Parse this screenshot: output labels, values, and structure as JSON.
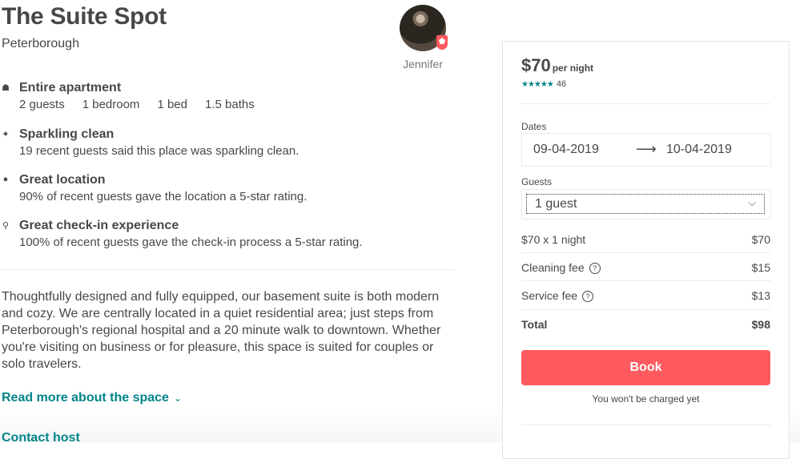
{
  "listing": {
    "title": "The Suite Spot",
    "city": "Peterborough",
    "host_name": "Jennifer"
  },
  "highlights": [
    {
      "icon": "home-icon",
      "title": "Entire apartment",
      "facts": [
        "2 guests",
        "1 bedroom",
        "1 bed",
        "1.5 baths"
      ]
    },
    {
      "icon": "sparkle-icon",
      "title": "Sparkling clean",
      "text": "19 recent guests said this place was sparkling clean."
    },
    {
      "icon": "location-pin-icon",
      "title": "Great location",
      "text": "90% of recent guests gave the location a 5-star rating."
    },
    {
      "icon": "key-icon",
      "title": "Great check-in experience",
      "text": "100% of recent guests gave the check-in process a 5-star rating."
    }
  ],
  "description": "Thoughtfully designed and fully equipped, our basement suite is both modern and cozy. We are centrally located in a quiet residential area; just steps from Peterborough's regional hospital and a 20 minute walk to downtown. Whether you're visiting on business or for pleasure, this space is suited for couples or solo travelers.",
  "read_more": "Read more about the space",
  "contact_host": "Contact host",
  "booking": {
    "price": "$70",
    "per_night": "per night",
    "stars": "★★★★★",
    "review_count": "46",
    "dates_label": "Dates",
    "check_in": "09-04-2019",
    "check_out": "10-04-2019",
    "guests_label": "Guests",
    "guests_value": "1 guest",
    "nightly_line": "$70 x 1 night",
    "nightly_amount": "$70",
    "cleaning_label": "Cleaning fee",
    "cleaning_amount": "$15",
    "service_label": "Service fee",
    "service_amount": "$13",
    "total_label": "Total",
    "total_amount": "$98",
    "book_label": "Book",
    "note": "You won't be charged yet"
  },
  "colors": {
    "accent": "#ff5a5f",
    "teal": "#008489",
    "text": "#484848"
  }
}
